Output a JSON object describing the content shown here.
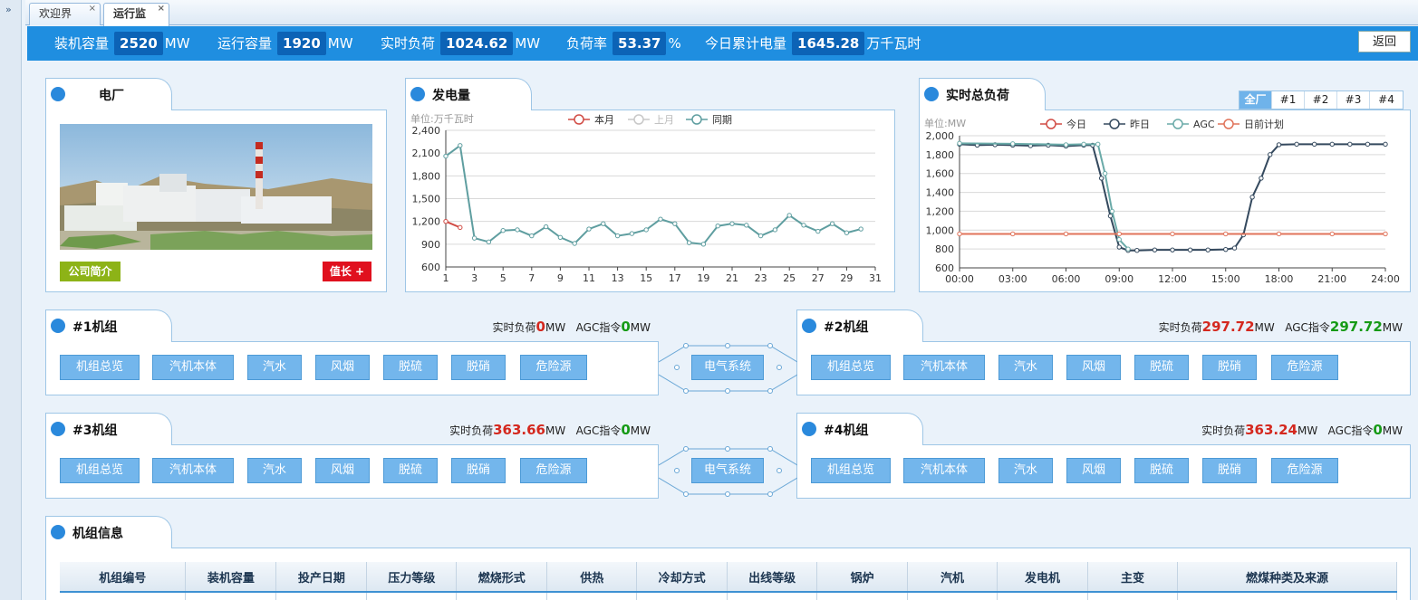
{
  "tabs": [
    {
      "label": "欢迎界面",
      "close": "×"
    },
    {
      "label": "运行监视",
      "close": "×"
    }
  ],
  "rail": {
    "toggle": "»"
  },
  "summary": {
    "installed": {
      "label": "装机容量",
      "value": "2520",
      "unit": "MW"
    },
    "running": {
      "label": "运行容量",
      "value": "1920",
      "unit": "MW"
    },
    "realtime": {
      "label": "实时负荷",
      "value": "1024.62",
      "unit": "MW"
    },
    "load_rate": {
      "label": "负荷率",
      "value": "53.37",
      "unit": "%"
    },
    "today_energy": {
      "label": "今日累计电量",
      "value": "1645.28",
      "unit": "万千瓦时"
    },
    "back": "返回"
  },
  "plant": {
    "title": "电厂",
    "intro_button": "公司简介",
    "duty_button": "值长 +"
  },
  "generation": {
    "title": "发电量",
    "unit_label": "单位:万千瓦时",
    "legend": [
      "本月",
      "上月",
      "同期"
    ]
  },
  "total_load": {
    "title": "实时总负荷",
    "unit_label": "单位:MW",
    "legend": [
      "今日",
      "昨日",
      "AGC",
      "日前计划"
    ],
    "range_tabs": [
      "全厂",
      "#1",
      "#2",
      "#3",
      "#4"
    ]
  },
  "units": [
    {
      "title": "#1机组",
      "load_label": "实时负荷",
      "load": "0",
      "load_unit": "MW",
      "agc_label": "AGC指令",
      "agc": "0",
      "agc_unit": "MW"
    },
    {
      "title": "#2机组",
      "load_label": "实时负荷",
      "load": "297.72",
      "load_unit": "MW",
      "agc_label": "AGC指令",
      "agc": "297.72",
      "agc_unit": "MW"
    },
    {
      "title": "#3机组",
      "load_label": "实时负荷",
      "load": "363.66",
      "load_unit": "MW",
      "agc_label": "AGC指令",
      "agc": "0",
      "agc_unit": "MW"
    },
    {
      "title": "#4机组",
      "load_label": "实时负荷",
      "load": "363.24",
      "load_unit": "MW",
      "agc_label": "AGC指令",
      "agc": "0",
      "agc_unit": "MW"
    }
  ],
  "unit_buttons": [
    "机组总览",
    "汽机本体",
    "汽水",
    "风烟",
    "脱硫",
    "脱硝",
    "危险源"
  ],
  "electrical_button": "电气系统",
  "unit_info": {
    "title": "机组信息",
    "columns": [
      "机组编号",
      "装机容量",
      "投产日期",
      "压力等级",
      "燃烧形式",
      "供热",
      "冷却方式",
      "出线等级",
      "锅炉",
      "汽机",
      "发电机",
      "主变",
      "燃煤种类及来源"
    ]
  },
  "chart_data": [
    {
      "type": "line",
      "title": "发电量",
      "ylabel": "单位:万千瓦时",
      "ylim": [
        600,
        2400
      ],
      "yticks": [
        "600",
        "900",
        "1,200",
        "1,500",
        "1,800",
        "2,100",
        "2,400"
      ],
      "xticks": [
        "1",
        "3",
        "5",
        "7",
        "9",
        "11",
        "13",
        "15",
        "17",
        "19",
        "21",
        "23",
        "25",
        "27",
        "29",
        "31"
      ],
      "xlim": [
        1,
        31
      ],
      "series": [
        {
          "name": "本月",
          "color": "#d14b44",
          "x": [
            1,
            2
          ],
          "values": [
            1200,
            1120
          ]
        },
        {
          "name": "上月",
          "color": "#c8c8c8",
          "x": [],
          "values": []
        },
        {
          "name": "同期",
          "color": "#5f9ea0",
          "x": [
            1,
            2,
            3,
            4,
            5,
            6,
            7,
            8,
            9,
            10,
            11,
            12,
            13,
            14,
            15,
            16,
            17,
            18,
            19,
            20,
            21,
            22,
            23,
            24,
            25,
            26,
            27,
            28,
            29,
            30
          ],
          "values": [
            2060,
            2200,
            980,
            930,
            1080,
            1090,
            1010,
            1130,
            990,
            910,
            1100,
            1170,
            1010,
            1040,
            1090,
            1230,
            1170,
            920,
            900,
            1140,
            1170,
            1150,
            1010,
            1090,
            1280,
            1150,
            1070,
            1170,
            1050,
            1100
          ]
        }
      ],
      "legend": "top"
    },
    {
      "type": "line",
      "title": "实时总负荷",
      "ylabel": "单位:MW",
      "ylim": [
        600,
        2000
      ],
      "yticks": [
        "600",
        "800",
        "1,000",
        "1,200",
        "1,400",
        "1,600",
        "1,800",
        "2,000"
      ],
      "xticks": [
        "00:00",
        "03:00",
        "06:00",
        "09:00",
        "12:00",
        "15:00",
        "18:00",
        "21:00",
        "24:00"
      ],
      "xlim": [
        0,
        24
      ],
      "series": [
        {
          "name": "今日",
          "color": "#d14b44",
          "x": [],
          "values": []
        },
        {
          "name": "昨日",
          "color": "#34495e",
          "x": [
            0,
            1,
            2,
            3,
            4,
            5,
            6,
            7,
            7.5,
            8,
            8.5,
            9,
            9.5,
            10,
            11,
            12,
            13,
            14,
            15,
            15.5,
            16,
            16.5,
            17,
            17.5,
            18,
            19,
            20,
            21,
            22,
            23,
            24
          ],
          "values": [
            1910,
            1900,
            1905,
            1900,
            1895,
            1900,
            1890,
            1900,
            1900,
            1550,
            1150,
            820,
            785,
            785,
            790,
            790,
            790,
            790,
            795,
            810,
            950,
            1350,
            1550,
            1800,
            1905,
            1910,
            1910,
            1910,
            1910,
            1910,
            1910
          ]
        },
        {
          "name": "AGC",
          "color": "#6aaaa8",
          "x": [
            0,
            3,
            6,
            7,
            7.8,
            8.2,
            8.6,
            9,
            9.5
          ],
          "values": [
            1920,
            1915,
            1905,
            1910,
            1910,
            1600,
            1200,
            900,
            800
          ]
        },
        {
          "name": "日前计划",
          "color": "#e0735a",
          "x": [
            0,
            3,
            6,
            9,
            12,
            15,
            18,
            21,
            24
          ],
          "values": [
            960,
            960,
            960,
            960,
            960,
            960,
            960,
            960,
            960
          ]
        }
      ],
      "legend": "top"
    }
  ]
}
